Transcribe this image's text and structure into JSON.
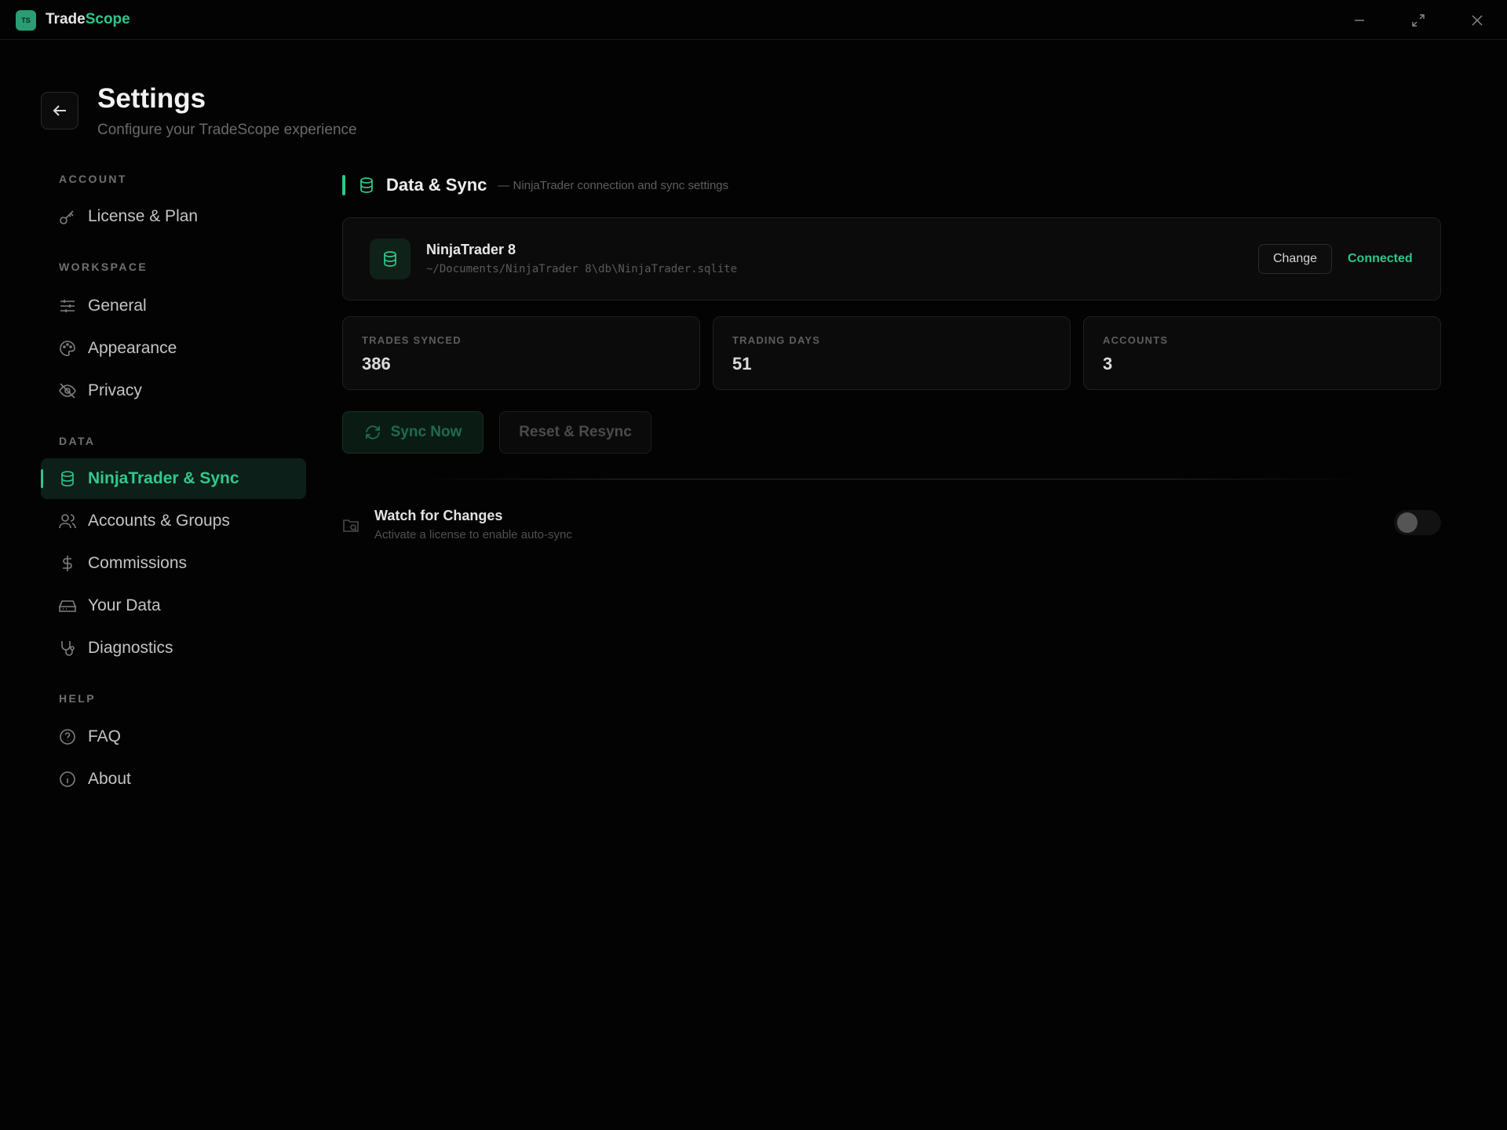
{
  "app": {
    "logo_text": "TS",
    "title_part1": "Trade",
    "title_part2": "Scope"
  },
  "window_controls": {
    "minimize": "minimize-icon",
    "maximize": "maximize-icon",
    "close": "close-icon"
  },
  "header": {
    "title": "Settings",
    "subtitle": "Configure your TradeScope experience"
  },
  "sidebar": {
    "sections": [
      {
        "label": "ACCOUNT",
        "items": [
          {
            "label": "License & Plan",
            "icon": "key-icon"
          }
        ]
      },
      {
        "label": "WORKSPACE",
        "items": [
          {
            "label": "General",
            "icon": "sliders-icon"
          },
          {
            "label": "Appearance",
            "icon": "palette-icon"
          },
          {
            "label": "Privacy",
            "icon": "eye-off-icon"
          }
        ]
      },
      {
        "label": "DATA",
        "items": [
          {
            "label": "NinjaTrader & Sync",
            "icon": "database-icon",
            "active": true
          },
          {
            "label": "Accounts & Groups",
            "icon": "users-icon"
          },
          {
            "label": "Commissions",
            "icon": "dollar-icon"
          },
          {
            "label": "Your Data",
            "icon": "hard-drive-icon"
          },
          {
            "label": "Diagnostics",
            "icon": "stethoscope-icon"
          }
        ]
      },
      {
        "label": "HELP",
        "items": [
          {
            "label": "FAQ",
            "icon": "help-circle-icon"
          },
          {
            "label": "About",
            "icon": "info-icon"
          }
        ]
      }
    ]
  },
  "main": {
    "section_title": "Data & Sync",
    "section_desc": "— NinjaTrader connection and sync settings",
    "connection": {
      "name": "NinjaTrader 8",
      "path": "~/Documents/NinjaTrader 8\\db\\NinjaTrader.sqlite",
      "change_label": "Change",
      "status": "Connected"
    },
    "stats": [
      {
        "label": "TRADES SYNCED",
        "value": "386"
      },
      {
        "label": "TRADING DAYS",
        "value": "51"
      },
      {
        "label": "ACCOUNTS",
        "value": "3"
      }
    ],
    "sync_label": "Sync Now",
    "reset_label": "Reset & Resync",
    "watch": {
      "title": "Watch for Changes",
      "subtitle": "Activate a license to enable auto-sync",
      "enabled": false
    }
  },
  "colors": {
    "accent": "#2fc68c",
    "background": "#030303"
  }
}
